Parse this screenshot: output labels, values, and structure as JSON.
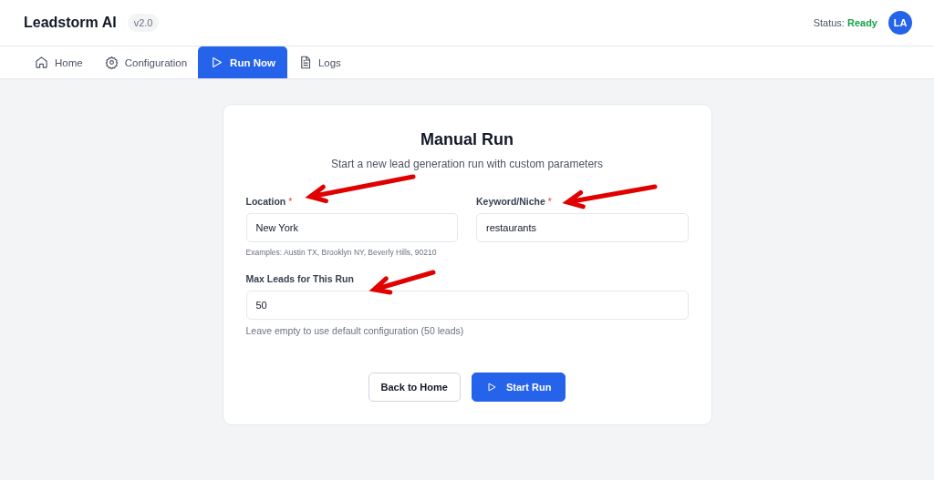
{
  "app": {
    "name": "Leadstorm AI",
    "version": "v2.0",
    "status_label": "Status:",
    "status_value": "Ready",
    "avatar": "LA"
  },
  "tabs": [
    {
      "label": "Home",
      "selected": false
    },
    {
      "label": "Configuration",
      "selected": false
    },
    {
      "label": "Run Now",
      "selected": true
    },
    {
      "label": "Logs",
      "selected": false
    }
  ],
  "form": {
    "title": "Manual Run",
    "subtitle": "Start a new lead generation run with custom parameters",
    "fields": [
      {
        "label": "Location",
        "required_mark": "*",
        "value": "New York",
        "hint": "Examples: Austin TX, Brooklyn NY, Beverly Hills, 90210"
      },
      {
        "label": "Keyword/Niche",
        "required_mark": "*",
        "value": "restaurants"
      },
      {
        "label": "Max Leads for This Run",
        "value": "50",
        "hint": "Leave empty to use default configuration (50 leads)"
      }
    ],
    "buttons": [
      {
        "label": "Back to Home",
        "kind": "secondary"
      },
      {
        "label": "Start Run",
        "kind": "primary"
      }
    ]
  }
}
